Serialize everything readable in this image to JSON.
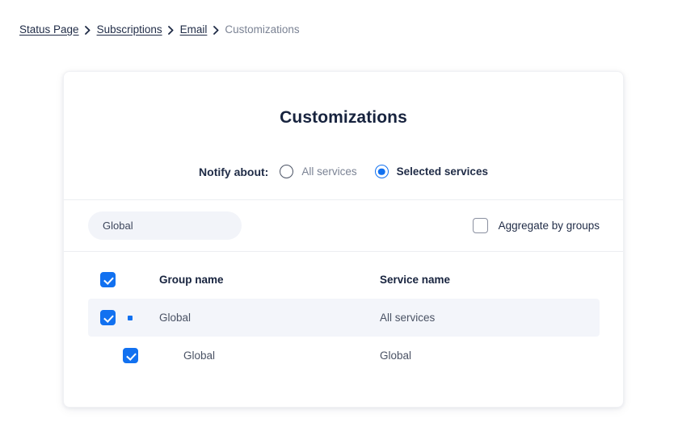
{
  "breadcrumb": {
    "items": [
      {
        "label": "Status Page",
        "current": false
      },
      {
        "label": "Subscriptions",
        "current": false
      },
      {
        "label": "Email",
        "current": false
      },
      {
        "label": "Customizations",
        "current": true
      }
    ],
    "separator_icon": "chevron-right-icon"
  },
  "card": {
    "title": "Customizations",
    "notify": {
      "label": "Notify about:",
      "options": [
        {
          "label": "All services",
          "selected": false
        },
        {
          "label": "Selected services",
          "selected": true
        }
      ]
    },
    "filter_bar": {
      "scope_chip": {
        "value": "Global",
        "placeholder": "Global"
      },
      "aggregate": {
        "label": "Aggregate by groups",
        "checked": false
      }
    },
    "table": {
      "select_all_checked": true,
      "columns": [
        {
          "key": "group",
          "label": "Group name"
        },
        {
          "key": "service",
          "label": "Service name"
        }
      ],
      "rows": [
        {
          "checked": true,
          "indent": false,
          "has_expander_dot": true,
          "highlighted": true,
          "group": "Global",
          "service": "All services"
        },
        {
          "checked": true,
          "indent": true,
          "has_expander_dot": false,
          "highlighted": false,
          "group": "Global",
          "service": "Global"
        }
      ]
    }
  },
  "colors": {
    "accent": "#1271f0",
    "text_dark": "#17233e",
    "text_body": "#4a5264",
    "text_muted": "#7b8394",
    "chip_bg": "#f2f4f9",
    "row_highlight": "#f3f5fa",
    "divider": "#eceef1",
    "page_bg": "#ffffff"
  }
}
